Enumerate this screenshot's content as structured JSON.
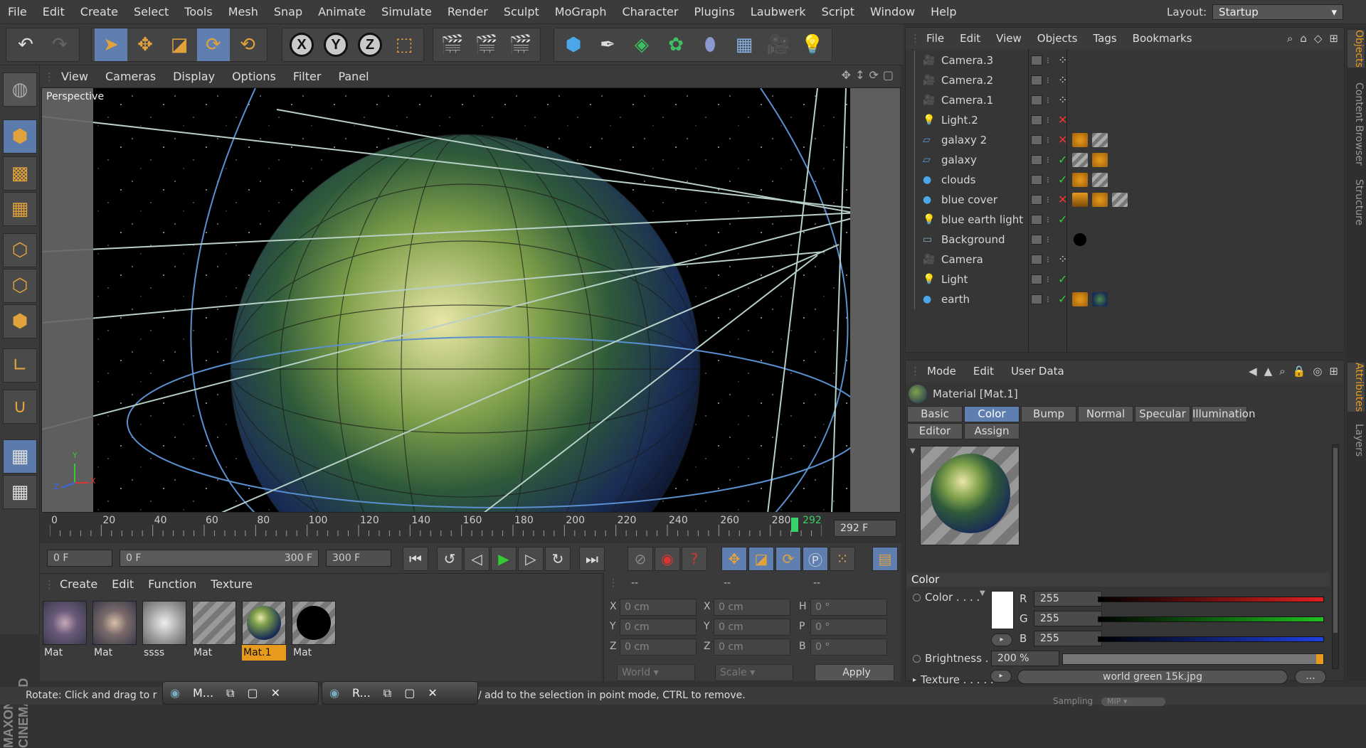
{
  "menubar": {
    "items": [
      "File",
      "Edit",
      "Create",
      "Select",
      "Tools",
      "Mesh",
      "Snap",
      "Animate",
      "Simulate",
      "Render",
      "Sculpt",
      "MoGraph",
      "Character",
      "Plugins",
      "Laubwerk",
      "Script",
      "Window",
      "Help"
    ],
    "layout_label": "Layout:",
    "layout_value": "Startup"
  },
  "toolbar": {
    "axis_x": "X",
    "axis_y": "Y",
    "axis_z": "Z"
  },
  "viewport": {
    "menu": [
      "View",
      "Cameras",
      "Display",
      "Options",
      "Filter",
      "Panel"
    ],
    "label": "Perspective",
    "axis_x": "X",
    "axis_y": "Y",
    "axis_z": "Z"
  },
  "timeline": {
    "ticks": [
      "0",
      "20",
      "40",
      "60",
      "80",
      "100",
      "120",
      "140",
      "160",
      "180",
      "200",
      "220",
      "240",
      "260",
      "280",
      "292"
    ],
    "current_frame": "292 F",
    "start_field": "0 F",
    "range_start": "0 F",
    "range_end": "300 F",
    "end_field": "300 F",
    "playhead_pct": 97.3
  },
  "materials": {
    "menu": [
      "Create",
      "Edit",
      "Function",
      "Texture"
    ],
    "items": [
      {
        "name": "Mat",
        "kind": "galaxy"
      },
      {
        "name": "Mat",
        "kind": "galaxy2"
      },
      {
        "name": "ssss",
        "kind": "clouds"
      },
      {
        "name": "Mat",
        "kind": "blank"
      },
      {
        "name": "Mat.1",
        "kind": "earth"
      },
      {
        "name": "Mat",
        "kind": "black"
      }
    ]
  },
  "coords": {
    "headers": [
      "--",
      "--",
      "--"
    ],
    "rows": [
      {
        "a": "X",
        "a_val": "0 cm",
        "b": "X",
        "b_val": "0 cm",
        "c": "H",
        "c_val": "0 °"
      },
      {
        "a": "Y",
        "a_val": "0 cm",
        "b": "Y",
        "b_val": "0 cm",
        "c": "P",
        "c_val": "0 °"
      },
      {
        "a": "Z",
        "a_val": "0 cm",
        "b": "Z",
        "b_val": "0 cm",
        "c": "B",
        "c_val": "0 °"
      }
    ],
    "space": "World",
    "mode": "Scale",
    "apply": "Apply"
  },
  "status": {
    "text_left": "Rotate: Click and drag to r",
    "text_right": "/ add to the selection in point mode, CTRL to remove.",
    "task1": "M...",
    "task2": "R..."
  },
  "objects": {
    "menu": [
      "File",
      "Edit",
      "View",
      "Objects",
      "Tags",
      "Bookmarks"
    ],
    "rows": [
      {
        "name": "Camera.3",
        "type": "camera",
        "status": "dots",
        "tags": []
      },
      {
        "name": "Camera.2",
        "type": "camera",
        "status": "dots",
        "tags": []
      },
      {
        "name": "Camera.1",
        "type": "camera",
        "status": "dots",
        "tags": []
      },
      {
        "name": "Light.2",
        "type": "light",
        "status": "x",
        "tags": []
      },
      {
        "name": "galaxy 2",
        "type": "plane",
        "status": "x",
        "tags": [
          "phong",
          "texture"
        ]
      },
      {
        "name": "galaxy",
        "type": "plane",
        "status": "check",
        "tags": [
          "texture",
          "phong"
        ]
      },
      {
        "name": "clouds",
        "type": "sphere",
        "status": "check",
        "tags": [
          "phong",
          "texture"
        ]
      },
      {
        "name": "blue cover",
        "type": "sphere",
        "status": "x",
        "tags": [
          "clapper",
          "phong",
          "texture"
        ]
      },
      {
        "name": "blue earth light",
        "type": "light",
        "status": "check",
        "tags": []
      },
      {
        "name": "Background",
        "type": "background",
        "status": "none",
        "tags": [
          "black"
        ]
      },
      {
        "name": "Camera",
        "type": "camera",
        "status": "dots",
        "tags": []
      },
      {
        "name": "Light",
        "type": "light",
        "status": "check",
        "tags": []
      },
      {
        "name": "earth",
        "type": "sphere",
        "status": "check",
        "tags": [
          "phong",
          "earth"
        ]
      }
    ]
  },
  "sidetabs": {
    "objects": "Objects",
    "content": "Content Browser",
    "structure": "Structure",
    "attributes": "Attributes",
    "layers": "Layers"
  },
  "attributes": {
    "menu": [
      "Mode",
      "Edit",
      "User Data"
    ],
    "title": "Material [Mat.1]",
    "tabs_row1": [
      "Basic",
      "Color",
      "Bump",
      "Normal",
      "Specular",
      "Illumination"
    ],
    "tabs_row2": [
      "Editor",
      "Assign"
    ],
    "selected_tab": "Color",
    "section": "Color",
    "color_label": "Color . . . .",
    "r_label": "R",
    "r_val": "255",
    "g_label": "G",
    "g_val": "255",
    "b_label": "B",
    "b_val": "255",
    "brightness_label": "Brightness . .",
    "brightness_val": "200 %",
    "texture_label": "Texture . . . . .",
    "texture_val": "world green 15k.jpg",
    "texture_more": "...",
    "sampling_label": "Sampling",
    "sampling_val": "MIP",
    "colors": {
      "red": "#e02020",
      "green": "#20c020",
      "blue": "#2040e0",
      "accent": "#5f7fb0",
      "selected_mat": "#e89a1c"
    }
  }
}
